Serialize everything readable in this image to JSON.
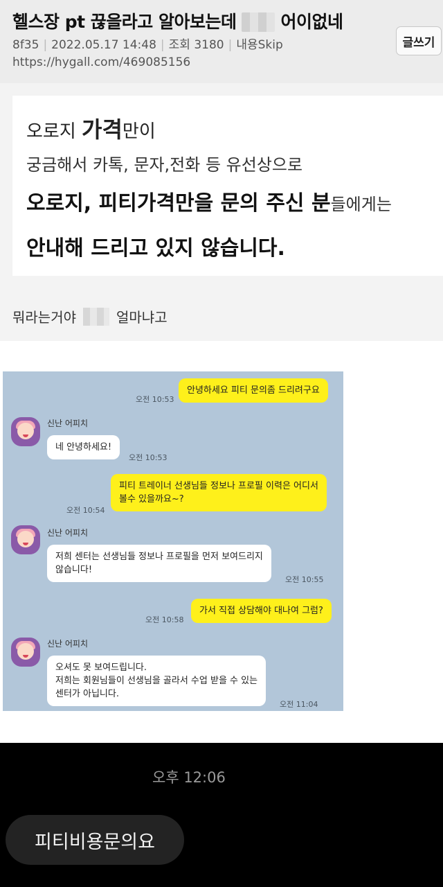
{
  "header": {
    "title_prefix": "헬스장 pt 끊을라고 알아보는데",
    "title_suffix": "어이없네",
    "author": "8f35",
    "date": "2022.05.17 14:48",
    "views": "조회 3180",
    "skip": "내용Skip",
    "url": "https://hygall.com/469085156",
    "write_label": "글쓰기"
  },
  "notice": {
    "line1_a": "오로지 ",
    "line1_b": "가격",
    "line1_c": "만이",
    "line2": "궁금해서  카톡, 문자,전화 등 유선상으로",
    "line3_a": "오로지, 피티가격만을 문의 주신 분",
    "line3_b": "들에게는",
    "line4": "안내해 드리고 있지 않습니다."
  },
  "caption": {
    "before": "뭐라는거야",
    "after": "얼마냐고"
  },
  "chat": {
    "messages": [
      {
        "text": "안녕하세요 피티 문의좀 드리려구요",
        "time": "오전 10:53"
      },
      {
        "sender": "신난 어피치",
        "text": "네 안녕하세요!",
        "time": "오전 10:53"
      },
      {
        "text_line1": "피티 트레이너 선생님들 정보나 프로필 이력은 어디서",
        "text_line2": "볼수 있을까요~?",
        "time": "오전 10:54"
      },
      {
        "sender": "신난 어피치",
        "text_line1": "저희 센터는 선생님들 정보나 프로필을 먼저 보여드리지",
        "text_line2": "않습니다!",
        "time": "오전 10:55"
      },
      {
        "text": "가서 직접 상담해야 대나여 그럼?",
        "time": "오전 10:58"
      },
      {
        "sender": "신난 어피치",
        "text_line1": "오셔도 못 보여드립니다.",
        "text_line2": "저희는 회원님들이 선생님을 골라서 수업 받을 수 있는",
        "text_line3": "센터가 아닙니다.",
        "time": "오전 11:04"
      }
    ]
  },
  "dark_message": {
    "time": "오후 12:06",
    "text": "피티비용문의요"
  }
}
